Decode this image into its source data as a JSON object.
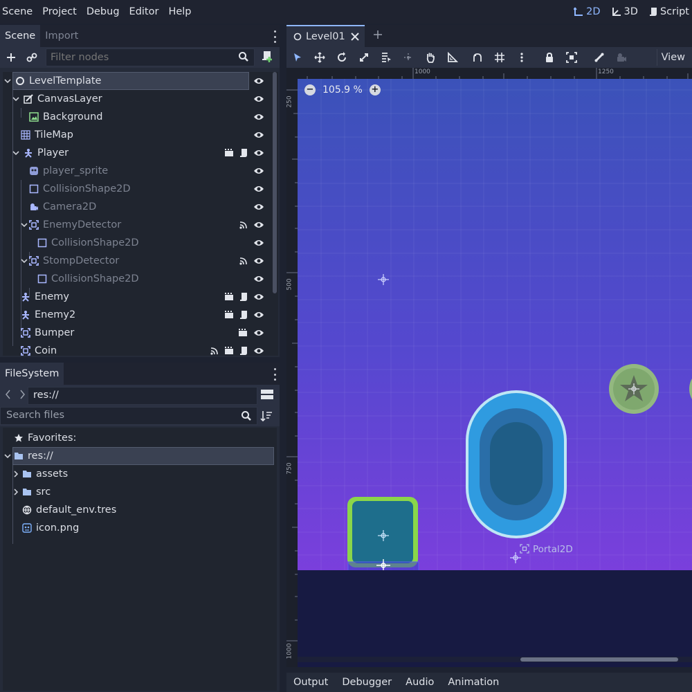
{
  "menu": [
    "Scene",
    "Project",
    "Debug",
    "Editor",
    "Help"
  ],
  "workspaces": [
    {
      "label": "2D",
      "icon": "2d-icon",
      "active": true
    },
    {
      "label": "3D",
      "icon": "3d-icon",
      "active": false
    },
    {
      "label": "Script",
      "icon": "script-icon",
      "active": false
    }
  ],
  "scene_dock": {
    "tabs": [
      "Scene",
      "Import"
    ],
    "filter_placeholder": "Filter nodes",
    "nodes": [
      {
        "label": "LevelTemplate",
        "icon": "node-icon",
        "selected": true,
        "dim": false,
        "indicators": []
      },
      {
        "label": "CanvasLayer",
        "icon": "canvas-layer-icon",
        "dim": false,
        "indicators": []
      },
      {
        "label": "Background",
        "icon": "texture-rect-icon",
        "dim": false,
        "indicators": []
      },
      {
        "label": "TileMap",
        "icon": "tilemap-icon",
        "dim": false,
        "indicators": []
      },
      {
        "label": "Player",
        "icon": "kinematic-body-icon",
        "dim": false,
        "indicators": [
          "scene-instance-icon",
          "script-icon"
        ]
      },
      {
        "label": "player_sprite",
        "icon": "sprite-icon",
        "dim": true,
        "indicators": []
      },
      {
        "label": "CollisionShape2D",
        "icon": "collision-shape-icon",
        "dim": true,
        "indicators": []
      },
      {
        "label": "Camera2D",
        "icon": "camera-icon",
        "dim": true,
        "indicators": []
      },
      {
        "label": "EnemyDetector",
        "icon": "area-icon",
        "dim": true,
        "indicators": [
          "signal-icon"
        ]
      },
      {
        "label": "CollisionShape2D",
        "icon": "collision-shape-icon",
        "dim": true,
        "indicators": []
      },
      {
        "label": "StompDetector",
        "icon": "area-icon",
        "dim": true,
        "indicators": [
          "signal-icon"
        ]
      },
      {
        "label": "CollisionShape2D",
        "icon": "collision-shape-icon",
        "dim": true,
        "indicators": []
      },
      {
        "label": "Enemy",
        "icon": "kinematic-body-icon",
        "dim": false,
        "indicators": [
          "scene-instance-icon",
          "script-icon"
        ]
      },
      {
        "label": "Enemy2",
        "icon": "kinematic-body-icon",
        "dim": false,
        "indicators": [
          "scene-instance-icon",
          "script-icon"
        ]
      },
      {
        "label": "Bumper",
        "icon": "area-icon",
        "dim": false,
        "indicators": [
          "scene-instance-icon"
        ]
      },
      {
        "label": "Coin",
        "icon": "area-icon",
        "dim": false,
        "indicators": [
          "signal-icon",
          "scene-instance-icon",
          "script-icon"
        ]
      }
    ]
  },
  "filesystem": {
    "tab": "FileSystem",
    "path": "res://",
    "search_placeholder": "Search files",
    "items": [
      {
        "label": "Favorites:",
        "icon": "star-icon"
      },
      {
        "label": "res://",
        "icon": "folder-icon",
        "selected": true
      },
      {
        "label": "assets",
        "icon": "folder-icon"
      },
      {
        "label": "src",
        "icon": "folder-icon"
      },
      {
        "label": "default_env.tres",
        "icon": "environment-icon"
      },
      {
        "label": "icon.png",
        "icon": "image-icon"
      }
    ]
  },
  "editor": {
    "scene_tab": "Level01",
    "view_menu": "View",
    "zoom": "105.9 %",
    "ruler_top": [
      "1000",
      "1250"
    ],
    "ruler_left": [
      "250",
      "500",
      "750",
      "1000"
    ],
    "portal_label": "Portal2D"
  },
  "bottom_panel": [
    "Output",
    "Debugger",
    "Audio",
    "Animation"
  ],
  "colors": {
    "accent": "#8fb7ff",
    "sky_top": "#3b52b9",
    "sky_bottom": "#7a3fdc",
    "ground": "#171a42",
    "player_green": "#8ad64a",
    "portal_blue": "#2f9be0"
  }
}
